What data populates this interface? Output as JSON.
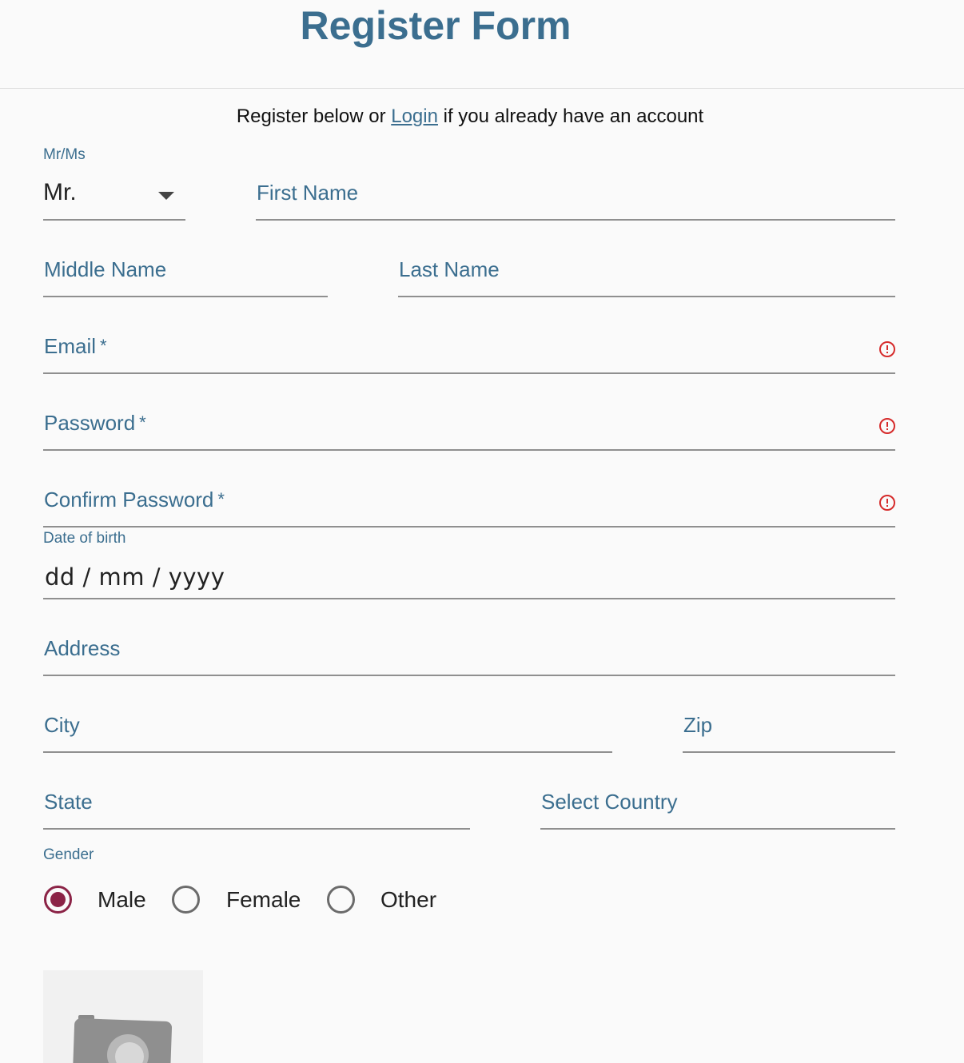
{
  "header": {
    "title": "Register Form"
  },
  "intro": {
    "before": "Register below or ",
    "login_link": "Login",
    "after": " if you already have an account"
  },
  "salutation": {
    "label": "Mr/Ms",
    "value": "Mr."
  },
  "fields": {
    "first_name": {
      "label": "First Name"
    },
    "middle_name": {
      "label": "Middle Name"
    },
    "last_name": {
      "label": "Last Name"
    },
    "email": {
      "label": "Email",
      "required_mark": "*"
    },
    "password": {
      "label": "Password",
      "required_mark": "*"
    },
    "confirm_password": {
      "label": "Confirm Password",
      "required_mark": "*"
    },
    "address": {
      "label": "Address"
    },
    "city": {
      "label": "City"
    },
    "zip": {
      "label": "Zip"
    },
    "state": {
      "label": "State"
    },
    "country": {
      "label": "Select Country"
    }
  },
  "dob": {
    "label": "Date of birth",
    "placeholder": "dd / mm / yyyy"
  },
  "gender": {
    "label": "Gender",
    "options": [
      {
        "label": "Male",
        "checked": true
      },
      {
        "label": "Female",
        "checked": false
      },
      {
        "label": "Other",
        "checked": false
      }
    ]
  },
  "photo": {
    "icon": "camera-icon"
  },
  "colors": {
    "accent": "#3b6e8f",
    "radio_checked": "#8b2346",
    "error": "#d62b2b"
  }
}
